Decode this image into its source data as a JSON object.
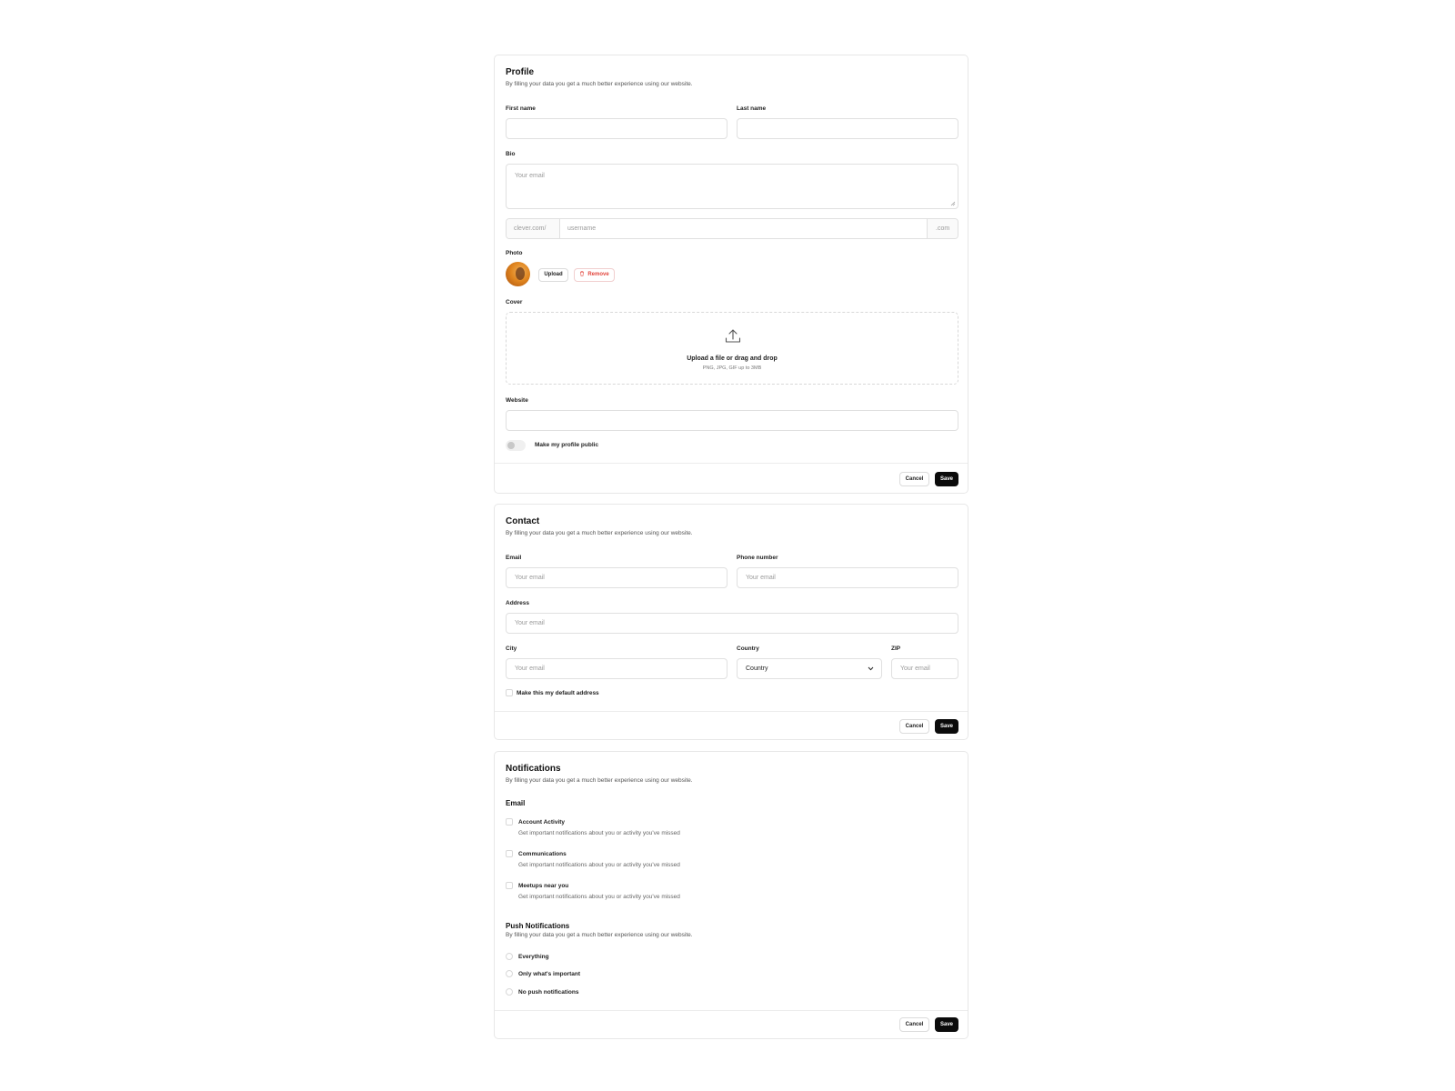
{
  "profile": {
    "title": "Profile",
    "subtitle": "By filling your data you get a much better experience using our website.",
    "first_name_label": "First name",
    "last_name_label": "Last name",
    "bio_label": "Bio",
    "bio_placeholder": "Your email",
    "username_prefix": "clever.com/",
    "username_placeholder": "username",
    "username_suffix": ".com",
    "photo_label": "Photo",
    "upload_button": "Upload",
    "remove_button": "Remove",
    "cover_label": "Cover",
    "cover_upload_text": "Upload a file or drag and drop",
    "cover_upload_hint": "PNG, JPG, GIF up to 3MB",
    "website_label": "Website",
    "public_toggle_label": "Make my profile public",
    "cancel_button": "Cancel",
    "save_button": "Save"
  },
  "contact": {
    "title": "Contact",
    "subtitle": "By filling your data you get a much better experience using our website.",
    "email_label": "Email",
    "email_placeholder": "Your email",
    "phone_label": "Phone number",
    "phone_placeholder": "Your email",
    "address_label": "Address",
    "address_placeholder": "Your email",
    "city_label": "City",
    "city_placeholder": "Your email",
    "country_label": "Country",
    "country_value": "Country",
    "zip_label": "ZIP",
    "zip_placeholder": "Your email",
    "default_address_label": "Make this my default address",
    "cancel_button": "Cancel",
    "save_button": "Save"
  },
  "notifications": {
    "title": "Notifications",
    "subtitle": "By filling your data you get a much better experience using our website.",
    "email_heading": "Email",
    "email_options": [
      {
        "title": "Account Activity",
        "desc": "Get important notifications about you or activity you've missed"
      },
      {
        "title": "Communications",
        "desc": "Get important notifications about you or activity you've missed"
      },
      {
        "title": "Meetups near you",
        "desc": "Get important notifications about you or activity you've missed"
      }
    ],
    "push_heading": "Push Notifications",
    "push_subtitle": "By filling your data you get a much better experience using our website.",
    "push_options": [
      "Everything",
      "Only what's important",
      "No push notifications"
    ],
    "cancel_button": "Cancel",
    "save_button": "Save"
  },
  "icons": {
    "avatar": "avatar-photo",
    "trash": "trash-icon",
    "upload": "upload-icon",
    "chevron": "chevron-down-icon"
  },
  "colors": {
    "primary": "#0b0b0b",
    "danger": "#e2453c",
    "border": "#e0e0e0",
    "avatar_orange": "#e0851f"
  }
}
